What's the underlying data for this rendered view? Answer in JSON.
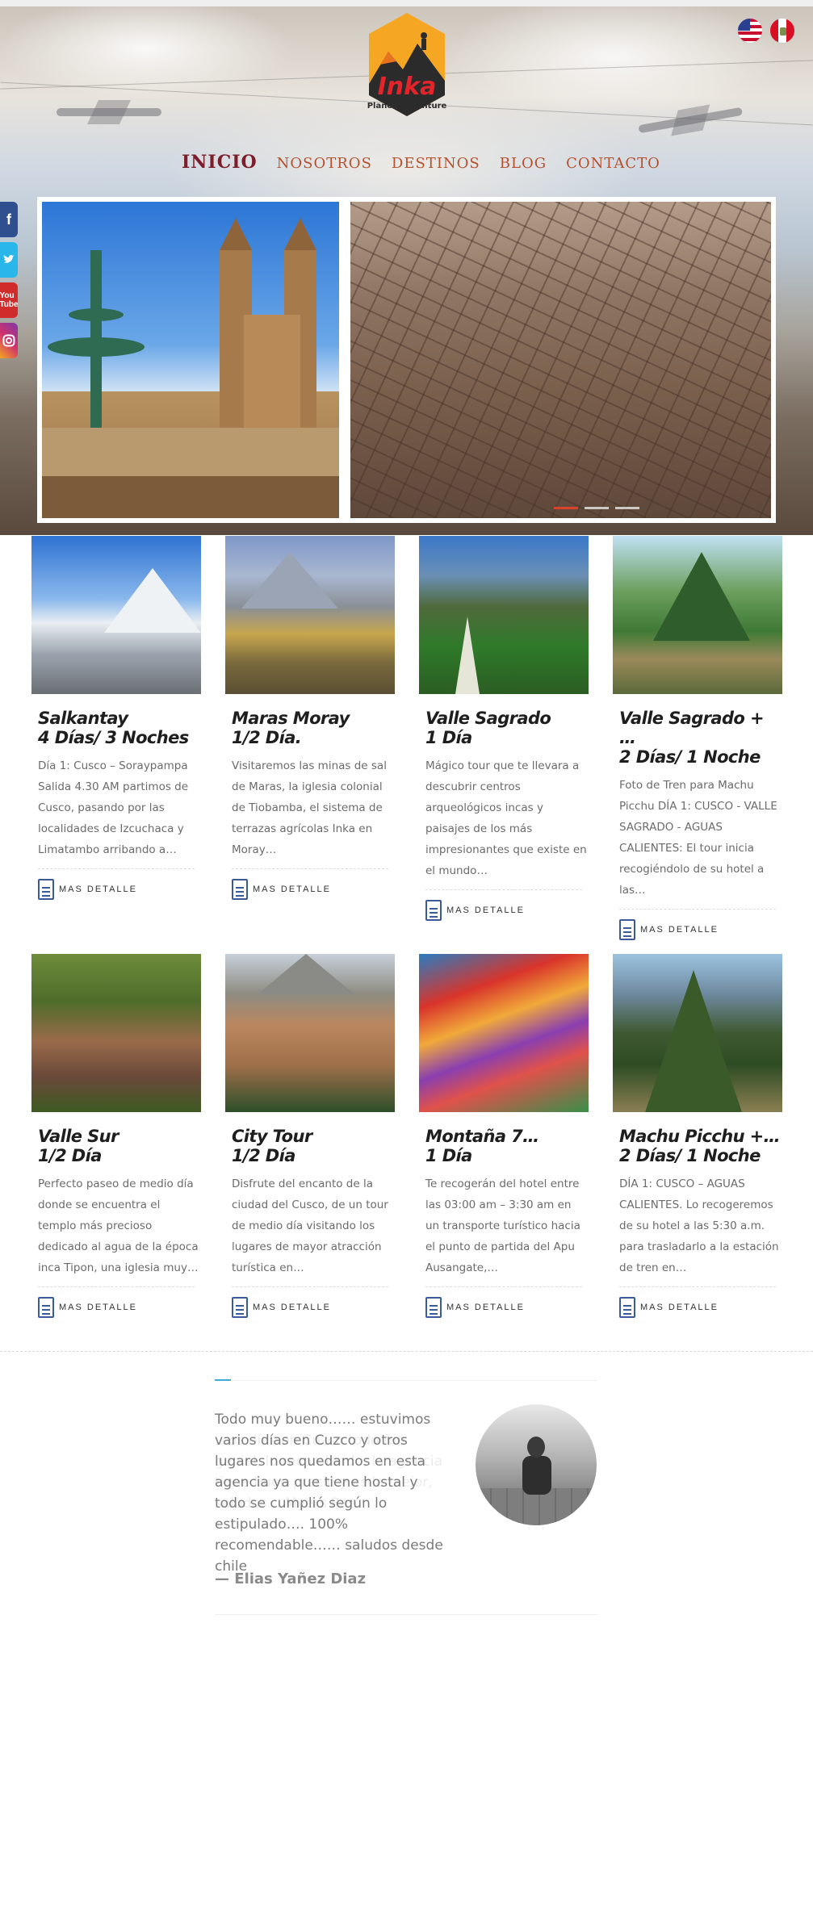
{
  "brand": {
    "name": "Inka",
    "tagline": "Planet Adventure"
  },
  "nav": [
    {
      "label": "INICIO",
      "active": true
    },
    {
      "label": "NOSOTROS",
      "active": false
    },
    {
      "label": "DESTINOS",
      "active": false
    },
    {
      "label": "BLOG",
      "active": false
    },
    {
      "label": "CONTACTO",
      "active": false
    }
  ],
  "languages": [
    "us-flag-icon",
    "peru-flag-icon"
  ],
  "social": [
    "facebook-icon",
    "twitter-icon",
    "youtube-icon",
    "instagram-icon"
  ],
  "social_labels": {
    "facebook": "f",
    "youtube": "You Tube"
  },
  "slider": {
    "active_slide": 1,
    "total_slides": 3
  },
  "more_label": "MAS DETALLE",
  "tours": [
    {
      "title1": "Salkantay",
      "title2": "4 Días/ 3 Noches",
      "desc": "Día 1: Cusco – Soraypampa Salida 4.30 AM partimos de Cusco, pasando por las localidades de Izcuchaca y Limatambo arribando a…"
    },
    {
      "title1": "Maras Moray",
      "title2": "1/2 Día.",
      "desc": "Visitaremos las minas de sal de Maras, la iglesia colonial de Tiobamba, el sistema de terrazas agrícolas Inka en Moray…"
    },
    {
      "title1": "Valle Sagrado",
      "title2": "1 Día",
      "desc": "Mágico tour que te llevara a descubrir centros arqueológicos incas y paisajes de los más impresionantes que existe en el mundo…"
    },
    {
      "title1": "Valle Sagrado + …",
      "title2": "2 Días/ 1 Noche",
      "desc": "Foto de Tren para Machu Picchu DÍA 1: CUSCO - VALLE SAGRADO - AGUAS CALIENTES: El tour inicia recogiéndolo de su hotel a las…"
    },
    {
      "title1": "Valle Sur",
      "title2": "1/2 Día",
      "desc": "Perfecto paseo de medio día donde se encuentra el templo más precioso dedicado al agua de la época inca Tipon, una iglesia muy…"
    },
    {
      "title1": "City Tour",
      "title2": "1/2 Día",
      "desc": "Disfrute del encanto de la ciudad del Cusco, de un tour de medio día visitando los lugares de mayor atracción turística en…"
    },
    {
      "title1": "Montaña 7…",
      "title2": "1 Día",
      "desc": "Te recogerán del hotel entre las 03:00 am – 3:30 am en un transporte turístico hacia el punto de partida del Apu Ausangate,…"
    },
    {
      "title1": "Machu Picchu +…",
      "title2": "2 Días/ 1 Noche",
      "desc": "DÍA 1: CUSCO – AGUAS CALIENTES. Lo recogeremos de su hotel a las 5:30 a.m. para trasladarlo a la estación de tren en…"
    }
  ],
  "testimonial": {
    "quote": "Todo muy bueno…… estuvimos varios días en Cuzco y otros lugares nos quedamos en esta agencia ya que tiene hostal y todo se cumplió según lo estipulado…. 100% recomendable…… saludos desde chile",
    "ghost_quote": "…os días en Cuzco todo fue genial, lo recomiendo, la agencia tiene buen precio y es la mejor, saludos… Myers Rae",
    "author": "— Elias Yañez Diaz"
  }
}
